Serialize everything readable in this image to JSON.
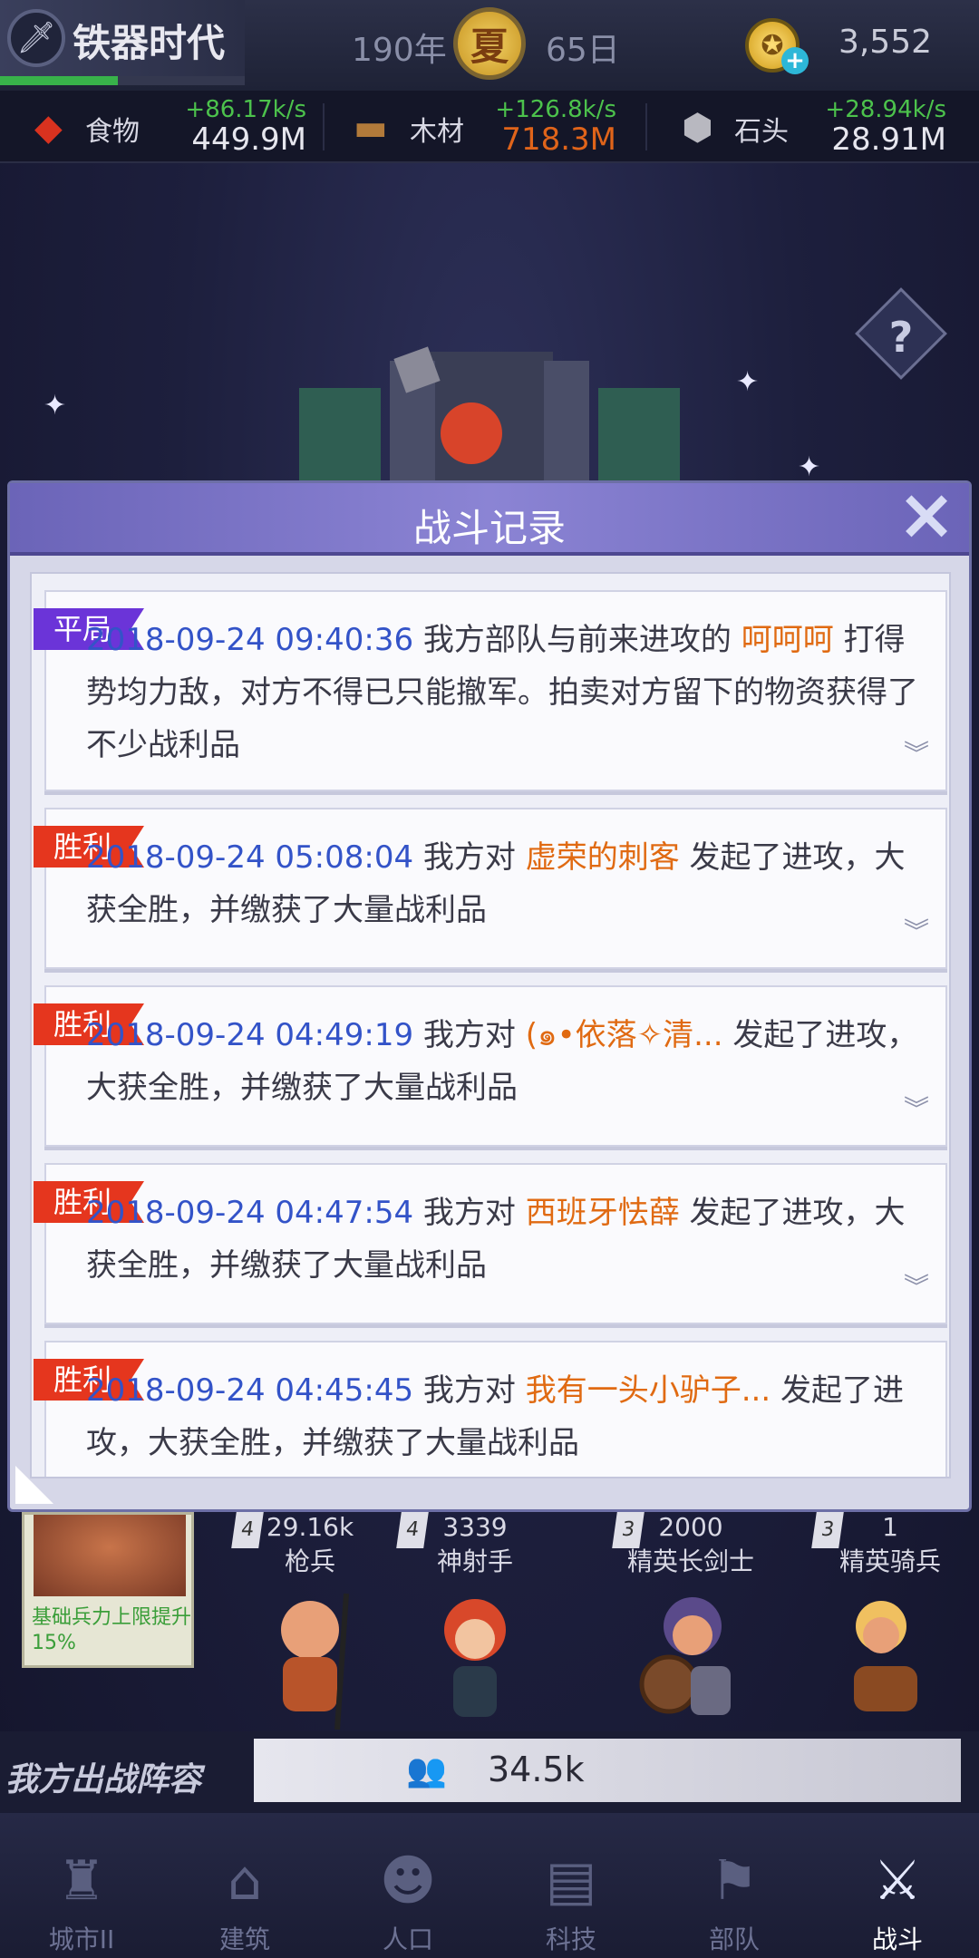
{
  "header": {
    "era_name": "铁器时代",
    "year": "190年",
    "season": "夏",
    "day": "65日",
    "currency_amount": "3,552",
    "era_progress": 0.48
  },
  "resources": [
    {
      "label": "食物",
      "rate": "+86.17k/s",
      "value": "449.9M",
      "value_color": "#e6e6ee"
    },
    {
      "label": "木材",
      "rate": "+126.8k/s",
      "value": "718.3M",
      "value_color": "#e0641a"
    },
    {
      "label": "石头",
      "rate": "+28.94k/s",
      "value": "28.91M",
      "value_color": "#e6e6ee"
    }
  ],
  "dialog": {
    "title": "战斗记录",
    "records": [
      {
        "tag": "平局",
        "timestamp": "2018-09-24 09:40:36",
        "pre": " 我方部队与前来进攻的 ",
        "opponent": "呵呵呵",
        "post": " 打得势均力敌，对方不得已只能撤军。拍卖对方留下的物资获得了不少战利品"
      },
      {
        "tag": "胜利",
        "timestamp": "2018-09-24 05:08:04",
        "pre": " 我方对 ",
        "opponent": "虚荣的刺客",
        "post": " 发起了进攻，大获全胜，并缴获了大量战利品"
      },
      {
        "tag": "胜利",
        "timestamp": "2018-09-24 04:49:19",
        "pre": " 我方对 ",
        "opponent": "(๑•依落✧清...",
        "post": " 发起了进攻，大获全胜，并缴获了大量战利品"
      },
      {
        "tag": "胜利",
        "timestamp": "2018-09-24 04:47:54",
        "pre": " 我方对 ",
        "opponent": "西班牙怯薛",
        "post": " 发起了进攻，大获全胜，并缴获了大量战利品"
      },
      {
        "tag": "胜利",
        "timestamp": "2018-09-24 04:45:45",
        "pre": " 我方对 ",
        "opponent": "我有一头小驴子...",
        "post": " 发起了进攻，大获全胜，并缴获了大量战利品"
      }
    ]
  },
  "army": {
    "bonus_text": "基础兵力上限提升15%",
    "units": [
      {
        "badge": "4",
        "count": "29.16k",
        "name": "枪兵"
      },
      {
        "badge": "4",
        "count": "3339",
        "name": "神射手"
      },
      {
        "badge": "3",
        "count": "2000",
        "name": "精英长剑士"
      },
      {
        "badge": "3",
        "count": "1",
        "name": "精英骑兵"
      }
    ],
    "lineup_label": "我方出战阵容",
    "lineup_value": "34.5k"
  },
  "nav": [
    {
      "label": "城市II",
      "icon": "castle-icon"
    },
    {
      "label": "建筑",
      "icon": "house-icon"
    },
    {
      "label": "人口",
      "icon": "person-icon"
    },
    {
      "label": "科技",
      "icon": "book-icon"
    },
    {
      "label": "部队",
      "icon": "banner-icon"
    },
    {
      "label": "战斗",
      "icon": "crossed-swords-icon",
      "active": true
    }
  ]
}
